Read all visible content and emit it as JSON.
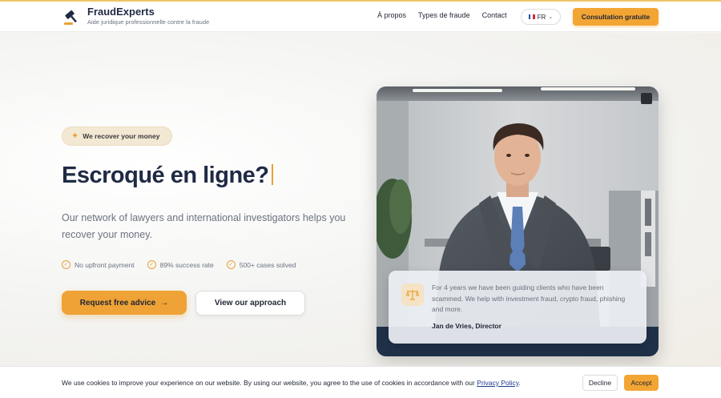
{
  "brand": {
    "name": "FraudExperts",
    "tagline": "Aide juridique professionnelle contre la fraude"
  },
  "nav": {
    "items": [
      "À propos",
      "Types de fraude",
      "Contact"
    ],
    "language": "FR",
    "cta_label": "Consultation gratuite"
  },
  "hero": {
    "badge": "We recover your money",
    "title": "Escroqué en ligne?",
    "lead": "Our network of lawyers and international investigators helps you recover your money.",
    "checks": [
      "No upfront payment",
      "89% success rate",
      "500+ cases solved"
    ],
    "primary_button": "Request free advice",
    "primary_arrow": "→",
    "secondary_button": "View our approach"
  },
  "testimonial": {
    "text": "For 4 years we have been guiding clients who have been scammed. We help with investment fraud, crypto fraud, phishing and more.",
    "author": "Jan de Vries, Director"
  },
  "cookie": {
    "text": "We use cookies to improve your experience on our website. By using our website, you agree to the use of cookies in accordance with our ",
    "link": "Privacy Policy",
    "suffix": ".",
    "decline": "Decline",
    "accept": "Accept"
  },
  "colors": {
    "accent": "#f3a534",
    "navy": "#1f2a44",
    "muted": "#6b7280"
  }
}
